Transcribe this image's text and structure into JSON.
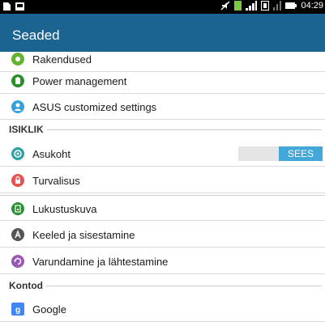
{
  "status_bar": {
    "time": "04:29",
    "icons": [
      "notification-icon",
      "message-icon",
      "mute-icon",
      "sim-icon",
      "signal-icon",
      "battery-icon"
    ]
  },
  "app_bar": {
    "title": "Seaded"
  },
  "items": {
    "rakendused": {
      "label": "Rakendused",
      "icon": "apps-icon",
      "color": "#65b330"
    },
    "power": {
      "label": "Power management",
      "icon": "power-icon",
      "color": "#2a8f28"
    },
    "asus": {
      "label": "ASUS customized settings",
      "icon": "asus-settings-icon",
      "color": "#3aa0d8"
    },
    "asukoht": {
      "label": "Asukoht",
      "icon": "location-icon",
      "color": "#2fa1a3",
      "toggle": "SEES"
    },
    "turvalisus": {
      "label": "Turvalisus",
      "icon": "lock-icon",
      "color": "#e55353"
    },
    "lukustuskuva": {
      "label": "Lukustuskuva",
      "icon": "lockscreen-icon",
      "color": "#2b8f34"
    },
    "keeled": {
      "label": "Keeled ja sisestamine",
      "icon": "language-icon",
      "color": "#555555"
    },
    "varundamine": {
      "label": "Varundamine ja lähtestamine",
      "icon": "backup-icon",
      "color": "#9b59b6"
    },
    "google": {
      "label": "Google",
      "icon": "google-icon",
      "color": "#4285f4"
    }
  },
  "sections": {
    "isiklik": "ISIKLIK",
    "kontod": "Kontod"
  },
  "colors": {
    "app_bar": "#1b6390",
    "toggle_on": "#43a7d9"
  }
}
